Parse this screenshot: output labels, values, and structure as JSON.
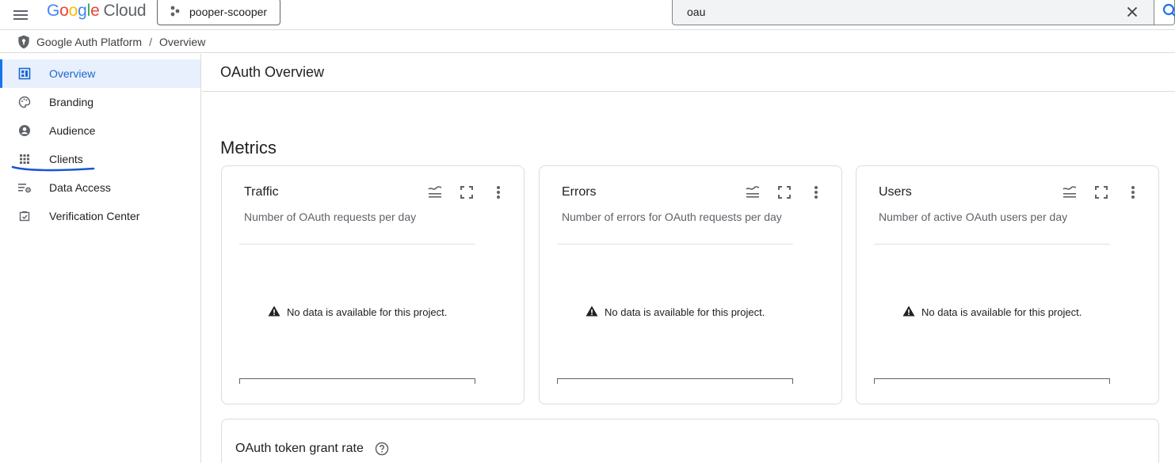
{
  "topbar": {
    "menu_icon": "hamburger-menu-icon",
    "logo": {
      "g1": "G",
      "o1": "o",
      "o2": "o",
      "g2": "g",
      "l": "l",
      "e": "e",
      "product": "Cloud"
    },
    "project": {
      "icon": "project-dots-icon",
      "name": "pooper-scooper"
    },
    "search": {
      "value": "oau",
      "clear_icon": "close-icon",
      "search_icon": "search-icon"
    }
  },
  "breadcrumb": {
    "icon": "shield-icon",
    "items": [
      "Google Auth Platform",
      "Overview"
    ],
    "separator": "/"
  },
  "sidebar": {
    "items": [
      {
        "label": "Overview",
        "icon": "dashboard-icon",
        "active": true
      },
      {
        "label": "Branding",
        "icon": "palette-icon",
        "active": false
      },
      {
        "label": "Audience",
        "icon": "account-circle-icon",
        "active": false
      },
      {
        "label": "Clients",
        "icon": "apps-grid-icon",
        "active": false
      },
      {
        "label": "Data Access",
        "icon": "list-settings-icon",
        "active": false
      },
      {
        "label": "Verification Center",
        "icon": "verified-checkbox-icon",
        "active": false
      }
    ]
  },
  "main": {
    "page_title": "OAuth Overview",
    "section_title": "Metrics",
    "cards": [
      {
        "title": "Traffic",
        "subtitle": "Number of OAuth requests per day",
        "empty_message": "No data is available for this project."
      },
      {
        "title": "Errors",
        "subtitle": "Number of errors for OAuth requests per day",
        "empty_message": "No data is available for this project."
      },
      {
        "title": "Users",
        "subtitle": "Number of active OAuth users per day",
        "empty_message": "No data is available for this project."
      }
    ],
    "grant_card": {
      "title": "OAuth token grant rate",
      "help_icon": "help-circle-icon"
    }
  },
  "colors": {
    "accent": "#1a73e8",
    "active_bg": "#e8f0fe",
    "annotation": "#1a56d6"
  }
}
